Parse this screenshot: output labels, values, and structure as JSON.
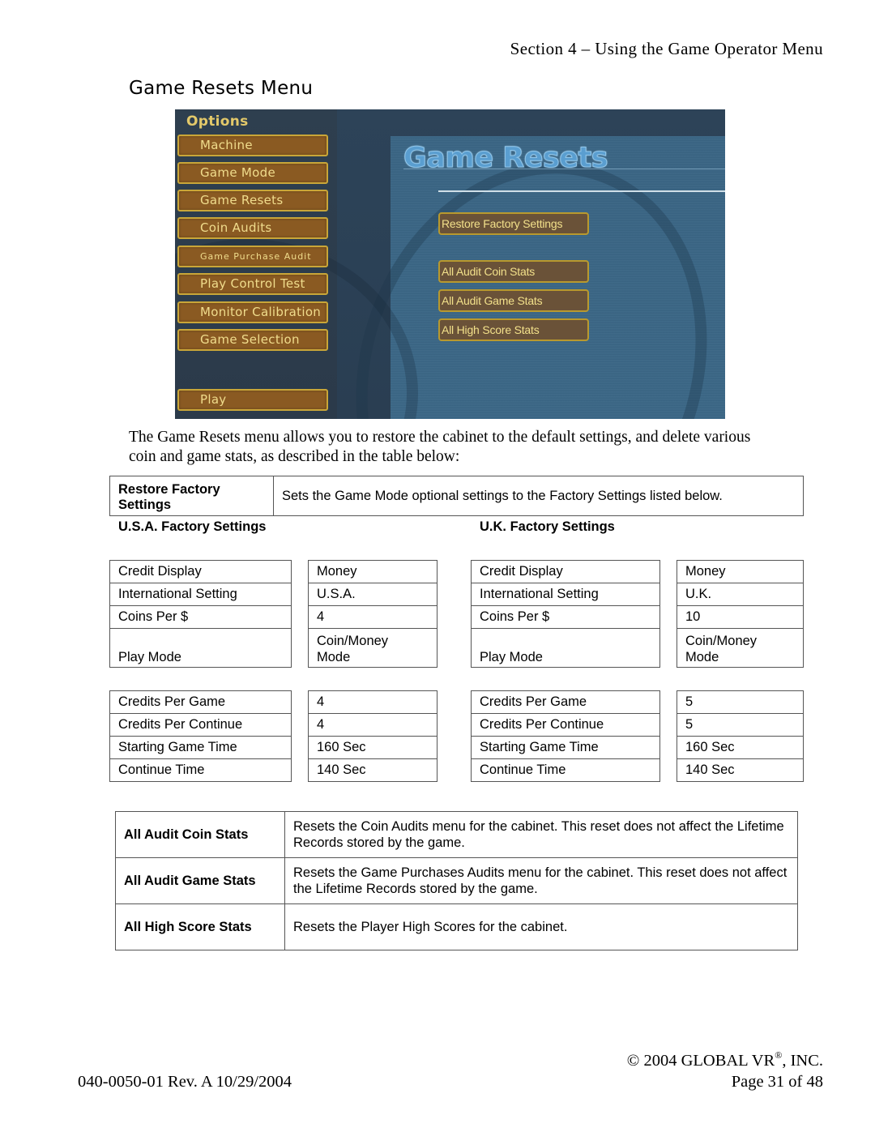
{
  "header": {
    "section": "Section 4  –  Using the Game Operator Menu",
    "page_title": "Game Resets Menu"
  },
  "game_screen": {
    "options_title": "Options",
    "menu_items": [
      {
        "label": "Machine"
      },
      {
        "label": "Game Mode"
      },
      {
        "label": "Game Resets"
      },
      {
        "label": "Coin Audits"
      },
      {
        "label": "Game Purchase Audit"
      },
      {
        "label": "Play Control Test"
      },
      {
        "label": "Monitor Calibration"
      },
      {
        "label": "Game Selection"
      },
      {
        "label": "Play"
      }
    ],
    "screen_title": "Game Resets",
    "actions": [
      {
        "label": "Restore Factory Settings"
      },
      {
        "label": "All Audit Coin Stats"
      },
      {
        "label": "All Audit Game Stats"
      },
      {
        "label": "All High Score Stats"
      }
    ],
    "colors": {
      "menu_button": "#8a5a22",
      "menu_border": "#c9a638",
      "menu_text": "#f0dc8c",
      "action_button": "#6a5238",
      "panel_blue": "#3a6584",
      "title_blue": "#5a9ed0"
    }
  },
  "intro": "The Game Resets menu allows you to restore the cabinet to the default settings, and delete various coin and game stats, as described in the table below:",
  "restore": {
    "label": "Restore Factory Settings",
    "description": "Sets the Game Mode optional settings to the Factory Settings listed below."
  },
  "usa": {
    "heading": "U.S.A.  Factory Settings",
    "group1": [
      {
        "name": "Credit Display",
        "value": "Money"
      },
      {
        "name": "International Setting",
        "value": "U.S.A."
      },
      {
        "name": "Coins Per $",
        "value": "4"
      },
      {
        "name": "Play Mode",
        "value": "Coin/Money Mode"
      }
    ],
    "group2": [
      {
        "name": "Credits Per Game",
        "value": "4"
      },
      {
        "name": "Credits Per Continue",
        "value": "4"
      },
      {
        "name": "Starting Game Time",
        "value": "160 Sec"
      },
      {
        "name": "Continue Time",
        "value": "140 Sec"
      }
    ]
  },
  "uk": {
    "heading": "U.K.  Factory Settings",
    "group1": [
      {
        "name": "Credit Display",
        "value": "Money"
      },
      {
        "name": "International Setting",
        "value": "U.K."
      },
      {
        "name": "Coins Per $",
        "value": "10"
      },
      {
        "name": "Play Mode",
        "value": "Coin/Money Mode"
      }
    ],
    "group2": [
      {
        "name": "Credits Per Game",
        "value": "5"
      },
      {
        "name": "Credits Per Continue",
        "value": "5"
      },
      {
        "name": "Starting Game Time",
        "value": "160 Sec"
      },
      {
        "name": "Continue Time",
        "value": "140 Sec"
      }
    ]
  },
  "stats": [
    {
      "label": "All Audit Coin Stats",
      "description": "Resets the Coin Audits menu for the cabinet. This reset does not affect the Lifetime Records stored by the game."
    },
    {
      "label": "All Audit Game Stats",
      "description": "Resets the Game Purchases Audits menu for the cabinet. This reset does not affect the Lifetime Records stored by the game."
    },
    {
      "label": "All High Score Stats",
      "description": "Resets the Player High Scores for the cabinet."
    }
  ],
  "footer": {
    "copyright_pre": "© 2004 GLOBAL VR",
    "copyright_mark": "®",
    "copyright_post": ", INC.",
    "doc_id": "040-0050-01 Rev. A 10/29/2004",
    "page": "Page 31 of 48"
  }
}
